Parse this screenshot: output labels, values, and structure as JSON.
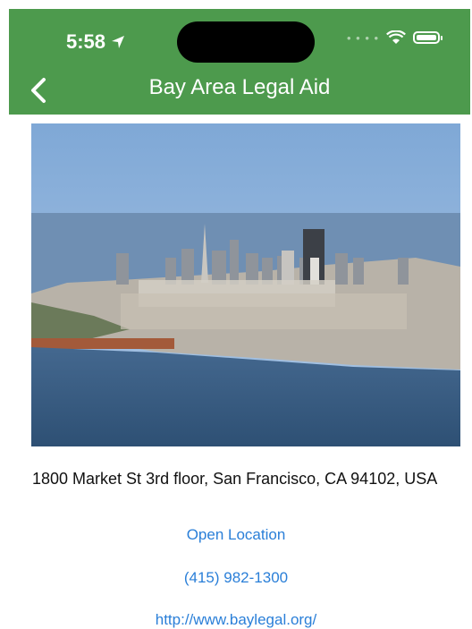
{
  "status_bar": {
    "time": "5:58"
  },
  "nav": {
    "title": "Bay Area Legal Aid"
  },
  "photo": {
    "alt": "San Francisco skyline"
  },
  "details": {
    "address": "1800 Market St 3rd floor, San Francisco, CA 94102, USA",
    "open_location": "Open Location",
    "phone": "(415) 982-1300",
    "website": "http://www.baylegal.org/"
  },
  "colors": {
    "header": "#4d9a4d",
    "link": "#2a7fd8"
  },
  "icons": [
    "location-arrow-icon",
    "wifi-icon",
    "battery-icon",
    "back-chevron-icon"
  ]
}
